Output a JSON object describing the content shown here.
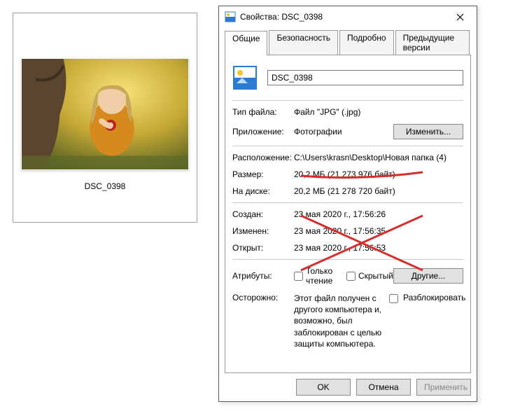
{
  "thumbnail": {
    "caption": "DSC_0398"
  },
  "dialog": {
    "title": "Свойства: DSC_0398",
    "tabs": {
      "general": "Общие",
      "security": "Безопасность",
      "details": "Подробно",
      "previous": "Предыдущие версии"
    },
    "filename": "DSC_0398",
    "labels": {
      "filetype": "Тип файла:",
      "app": "Приложение:",
      "location": "Расположение:",
      "size": "Размер:",
      "sizeOnDisk": "На диске:",
      "created": "Создан:",
      "modified": "Изменен:",
      "accessed": "Открыт:",
      "attributes": "Атрибуты:",
      "warning": "Осторожно:"
    },
    "values": {
      "filetype": "Файл \"JPG\" (.jpg)",
      "app": "Фотографии",
      "location": "C:\\Users\\krasn\\Desktop\\Новая папка (4)",
      "size": "20,2 МБ (21 273 976 байт)",
      "sizeOnDisk": "20,2 МБ (21 278 720 байт)",
      "created": "23 мая 2020 г., 17:56:26",
      "modified": "23 мая 2020 г., 17:56:35",
      "accessed": "23 мая 2020 г., 17:56:53"
    },
    "buttons": {
      "change": "Изменить...",
      "advanced": "Другие...",
      "ok": "OK",
      "cancel": "Отмена",
      "apply": "Применить"
    },
    "checkboxes": {
      "readonly": "Только чтение",
      "hidden": "Скрытый",
      "unblock": "Разблокировать"
    },
    "warningText": "Этот файл получен с другого компьютера и, возможно, был заблокирован с целью защиты компьютера."
  }
}
